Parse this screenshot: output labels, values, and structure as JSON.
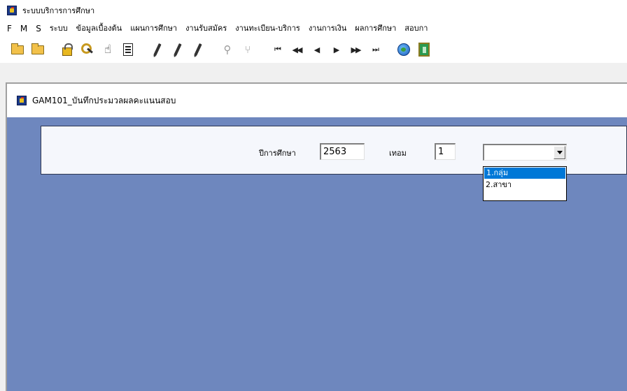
{
  "window": {
    "title": "ระบบบริการการศึกษา"
  },
  "menubar": {
    "items": [
      "F",
      "M",
      "S",
      "ระบบ",
      "ข้อมูลเบื้องต้น",
      "แผนการศึกษา",
      "งานรับสมัคร",
      "งานทะเบียน-บริการ",
      "งานการเงิน",
      "ผลการศึกษา",
      "สอบกา"
    ]
  },
  "toolbar": {
    "icons": [
      "open-folder-icon",
      "save-folder-icon",
      "lock-icon",
      "keys-icon",
      "hand-icon",
      "document-icon",
      "pencil-icon",
      "pencil-add-icon",
      "pencil-edit-icon",
      "binoculars-icon",
      "filter-icon",
      "first-record-icon",
      "rewind-icon",
      "previous-icon",
      "next-icon",
      "fast-forward-icon",
      "last-record-icon",
      "globe-icon",
      "exit-door-icon"
    ],
    "nav_glyphs": {
      "first": "⏮",
      "rewind": "◀◀",
      "prev": "◀",
      "next": "▶",
      "fast_forward": "▶▶",
      "last": "⏭"
    }
  },
  "child_window": {
    "title": "GAM101_บันทึกประมวลผลคะแนนสอบ"
  },
  "form": {
    "academic_year_label": "ปีการศึกษา",
    "academic_year_value": "2563",
    "semester_label": "เทอม",
    "semester_value": "1",
    "type_select_value": "",
    "type_options": [
      "1.กลุ่ม",
      "2.สาขา"
    ],
    "type_highlighted": "1.กลุ่ม"
  },
  "colors": {
    "form_background": "#6e87be",
    "panel_background": "#f5f7fc",
    "selection": "#0078d7"
  }
}
